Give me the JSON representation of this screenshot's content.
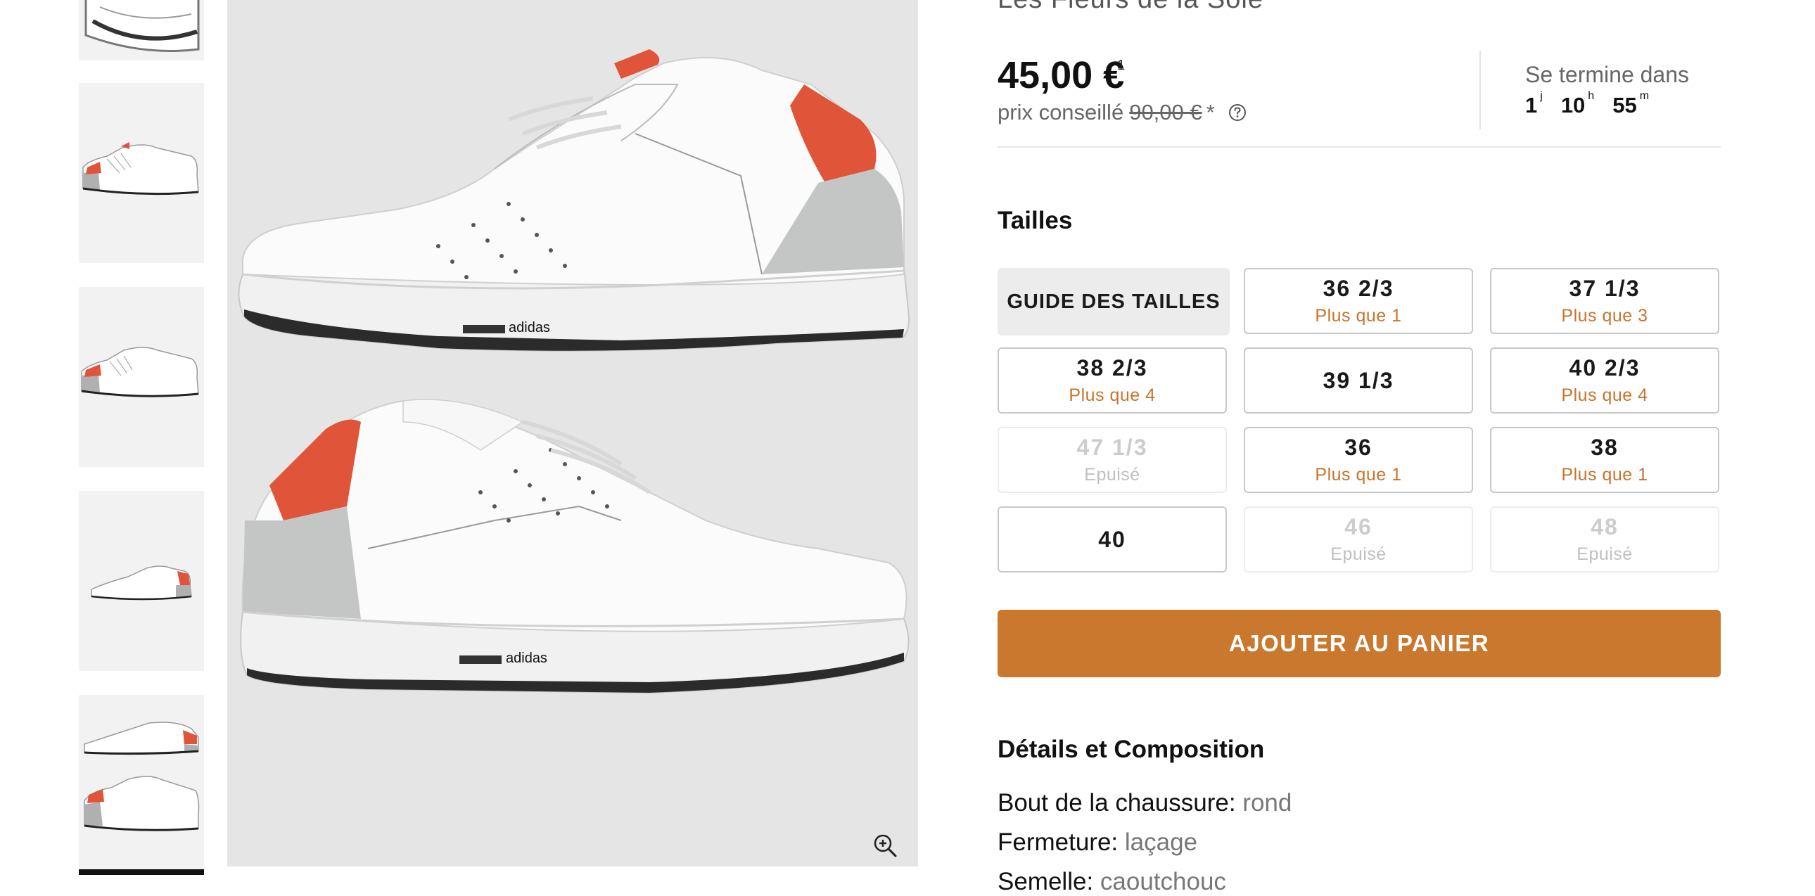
{
  "colors": {
    "accent": "#c9782d",
    "stock_text": "#c8742a",
    "shoe_accent_red": "#e0553a",
    "image_background": "#e5e5e5"
  },
  "top_cut_text": "Les Fleurs de la Sole",
  "gallery": {
    "thumbnails": [
      {
        "label": "adidas sneaker thumbnail top"
      },
      {
        "label": "adidas sneaker thumbnail side"
      },
      {
        "label": "adidas sneaker thumbnail side 2"
      },
      {
        "label": "adidas sneaker thumbnail angled"
      },
      {
        "label": "adidas sneaker thumbnail pair"
      }
    ],
    "brand_label": "adidas",
    "zoom_icon": "zoom-in-icon"
  },
  "price": {
    "current": "45,00 €",
    "footnote": "1",
    "rrp_label": "prix conseillé",
    "rrp_value": "90,00 €",
    "rrp_asterisk": "*",
    "help_icon": "question-circle-icon"
  },
  "countdown": {
    "label": "Se termine dans",
    "days": "1",
    "days_unit": "j",
    "hours": "10",
    "hours_unit": "h",
    "minutes": "55",
    "minutes_unit": "m"
  },
  "sizes": {
    "title": "Tailles",
    "guide_label": "GUIDE DES TAILLES",
    "options": [
      {
        "size": "36 2/3",
        "status": "Plus que 1",
        "available": true
      },
      {
        "size": "37 1/3",
        "status": "Plus que 3",
        "available": true
      },
      {
        "size": "38 2/3",
        "status": "Plus que 4",
        "available": true
      },
      {
        "size": "39 1/3",
        "status": "",
        "available": true
      },
      {
        "size": "40 2/3",
        "status": "Plus que 4",
        "available": true
      },
      {
        "size": "47 1/3",
        "status": "Epuisé",
        "available": false
      },
      {
        "size": "36",
        "status": "Plus que 1",
        "available": true
      },
      {
        "size": "38",
        "status": "Plus que 1",
        "available": true
      },
      {
        "size": "40",
        "status": "",
        "available": true
      },
      {
        "size": "46",
        "status": "Epuisé",
        "available": false
      },
      {
        "size": "48",
        "status": "Epuisé",
        "available": false
      }
    ]
  },
  "cart": {
    "label": "AJOUTER AU PANIER"
  },
  "details": {
    "title": "Détails et Composition",
    "rows": [
      {
        "label": "Bout de la chaussure:",
        "value": "rond"
      },
      {
        "label": "Fermeture:",
        "value": "laçage"
      },
      {
        "label": "Semelle:",
        "value": "caoutchouc"
      }
    ]
  }
}
